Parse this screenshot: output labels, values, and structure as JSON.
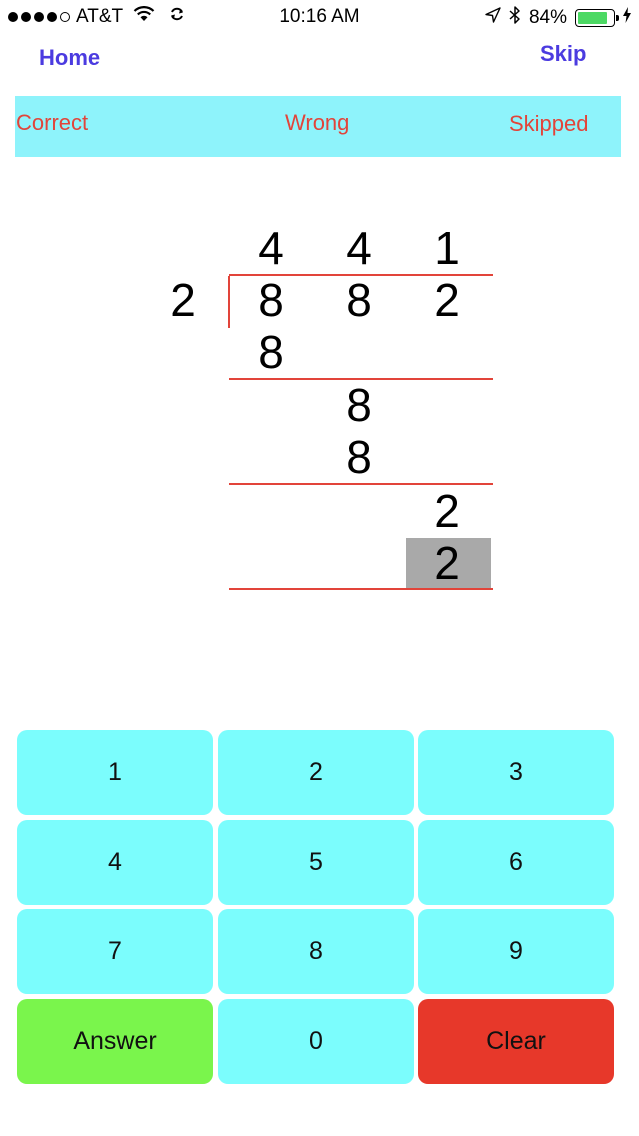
{
  "status_bar": {
    "carrier": "AT&T",
    "time": "10:16 AM",
    "battery_percent": "84%",
    "battery_level": 0.84,
    "signal_dots_filled": 4,
    "signal_dots_total": 5,
    "icons": [
      "wifi-icon",
      "sync-icon",
      "location-arrow-icon",
      "bluetooth-icon",
      "battery-icon",
      "charging-bolt-icon"
    ],
    "battery_fill_color": "#4cd964"
  },
  "nav": {
    "home_label": "Home",
    "skip_label": "Skip",
    "color": "#4b3be0"
  },
  "score_band": {
    "correct_label": "Correct",
    "wrong_label": "Wrong",
    "skipped_label": "Skipped",
    "background": "#8ef3fb",
    "label_color": "#e2443a"
  },
  "division": {
    "divisor": "2",
    "dividend": [
      "8",
      "8",
      "2"
    ],
    "quotient": [
      "4",
      "4",
      "1"
    ],
    "steps": [
      {
        "product": "8"
      },
      {
        "remainder": "8",
        "product": "8"
      },
      {
        "remainder": "2",
        "product": "2"
      }
    ],
    "active_cell_value": "2",
    "rule_color": "#e2443a"
  },
  "keypad": {
    "keys": [
      "1",
      "2",
      "3",
      "4",
      "5",
      "6",
      "7",
      "8",
      "9"
    ],
    "answer_label": "Answer",
    "zero_label": "0",
    "clear_label": "Clear",
    "key_color": "#7bfdfd",
    "answer_color": "#7af54c",
    "clear_color": "#e7382a"
  }
}
